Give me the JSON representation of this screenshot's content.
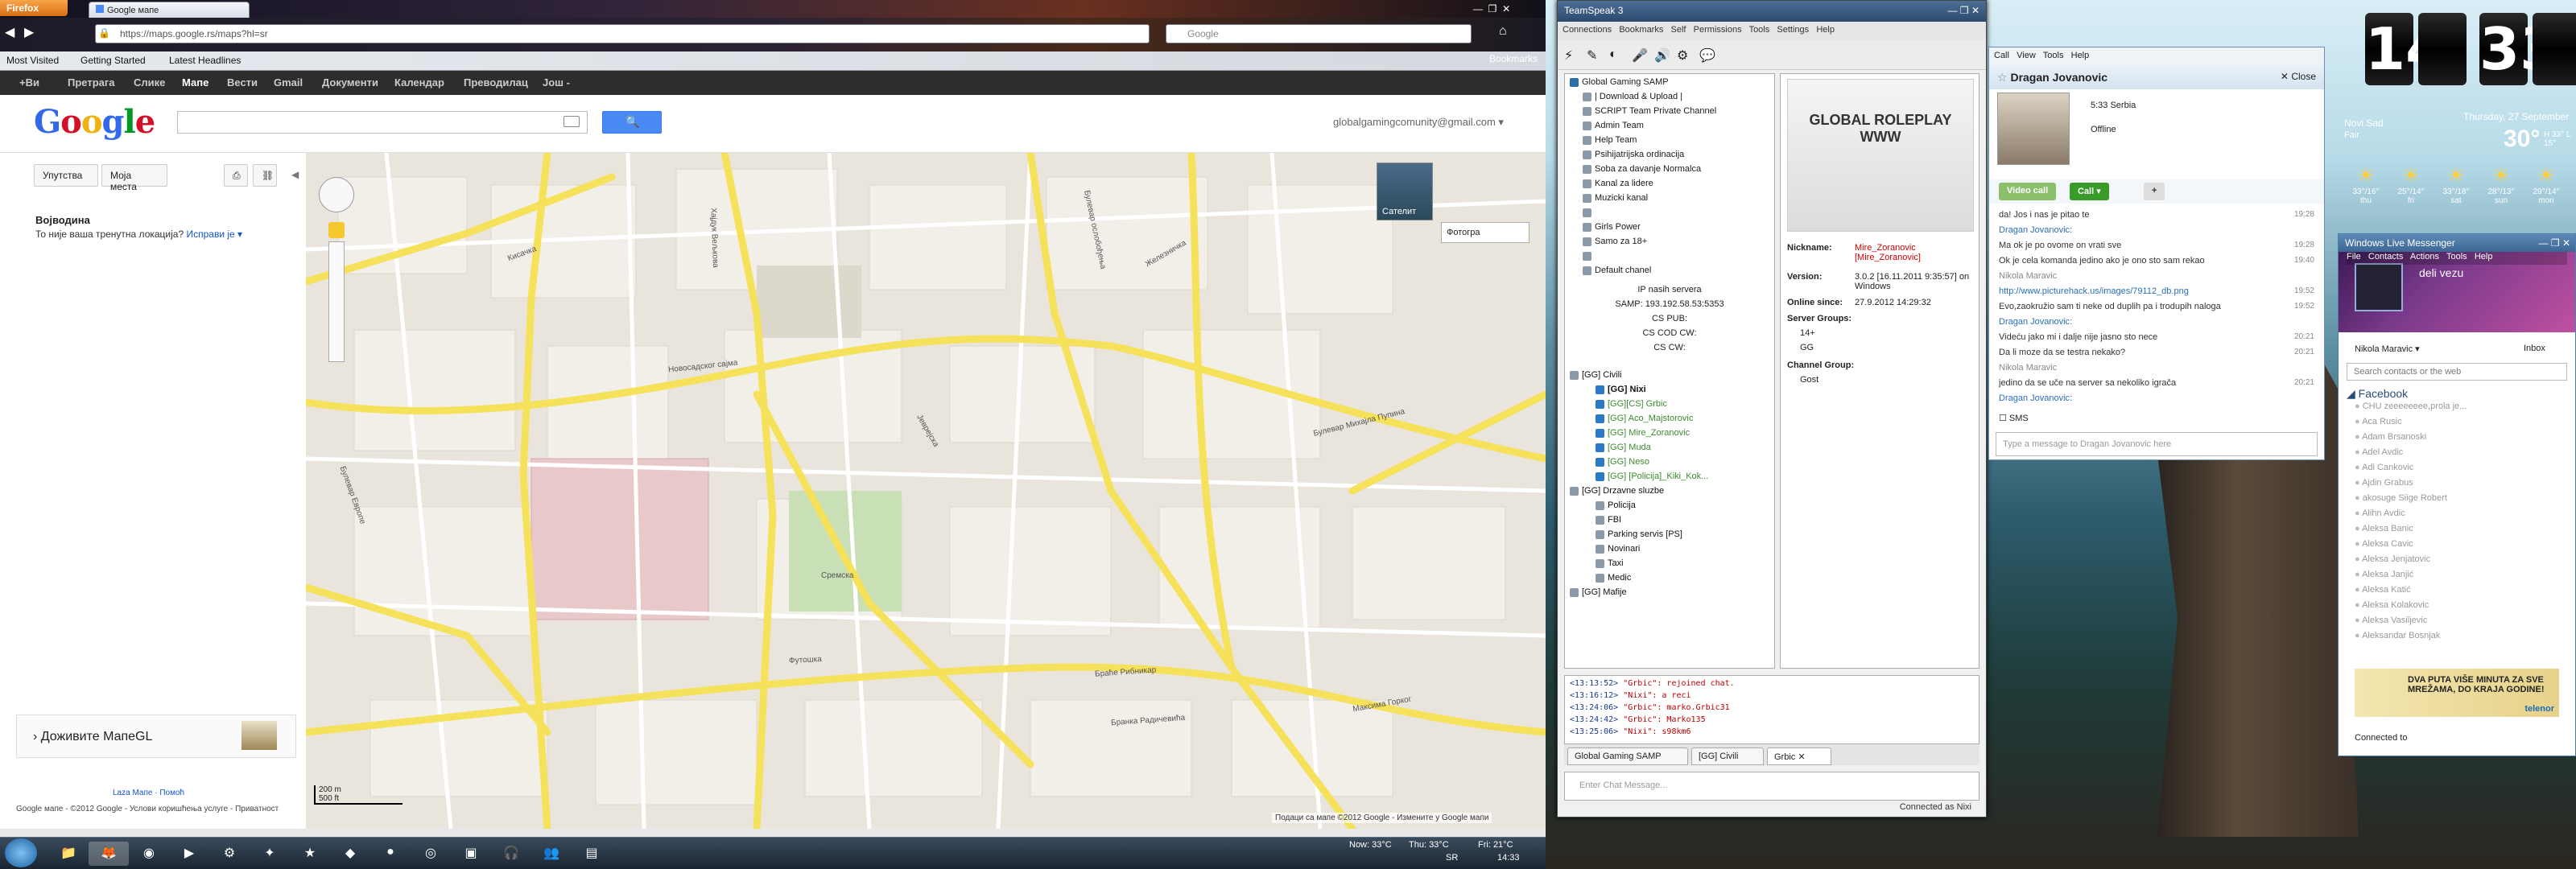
{
  "firefox": {
    "menu_label": "Firefox",
    "tab_label": "Google мапе",
    "url": "https://maps.google.rs/maps?hl=sr",
    "search_placeholder": "Google",
    "bookmarks": [
      "Most Visited",
      "Getting Started",
      "Latest Headlines"
    ],
    "bookmarks_right": "Bookmarks"
  },
  "gbar": {
    "items": [
      "+Ви",
      "Претрага",
      "Слике",
      "Мапе",
      "Вести",
      "Gmail",
      "Документи",
      "Календар",
      "Преводилац",
      "Још -"
    ]
  },
  "google": {
    "logo": "Google",
    "account": "globalgamingcomunity@gmail.com ▾",
    "buttons": [
      "Упутства",
      "Моја места"
    ],
    "region_title": "Војводина",
    "region_note": "То није ваша тренутна локација?",
    "region_fix": "Исправи је ▾",
    "maps_gl": "Доживите МапеGL",
    "footer1": "Laza Мапе · Помоћ",
    "footer2": "Google мапе - ©2012 Google - Услови коришћења услуге - Приватност",
    "map_type": "Сателит",
    "map_photos": "Фотогра",
    "scale_m": "200 m",
    "scale_ft": "500 ft",
    "map_copyright": "Подаци са мапе ©2012 Google - Измените у Google мапи",
    "map_streets": [
      "Булевар ослобођења",
      "Новосадског сајма",
      "Футошка",
      "Булевар Европе",
      "Јеврејска",
      "Бранка Радичевића",
      "Хајдук Вељкова",
      "Булевар Михајла Пупина",
      "Браће Рибникар",
      "Максима Горког",
      "Сремска",
      "Железничка",
      "Кисачка"
    ]
  },
  "taskbar": {
    "weather_now": "Now: 33°C",
    "weather_thu": "Thu: 33°C",
    "weather_fri": "Fri: 21°C",
    "lang": "SR",
    "time": "14:33"
  },
  "teamspeak": {
    "title": "TeamSpeak 3",
    "menu": [
      "Connections",
      "Bookmarks",
      "Self",
      "Permissions",
      "Tools",
      "Settings",
      "Help"
    ],
    "channels": [
      {
        "name": "Global Gaming SAMP",
        "level": 0,
        "color": "#1a1a1a"
      },
      {
        "name": "| Download & Upload |",
        "level": 1,
        "color": "#1a1a1a"
      },
      {
        "name": "SCRIPT Team Private Channel",
        "level": 1,
        "color": "#1a1a1a"
      },
      {
        "name": "Admin Team",
        "level": 1,
        "color": "#1a1a1a"
      },
      {
        "name": "Help Team",
        "level": 1,
        "color": "#1a1a1a"
      },
      {
        "name": "Psihijatrijska ordinacija",
        "level": 1,
        "color": "#1a1a1a"
      },
      {
        "name": "Soba za davanje Normalca",
        "level": 1,
        "color": "#1a1a1a"
      },
      {
        "name": "Kanal za lidere",
        "level": 1,
        "color": "#1a1a1a"
      },
      {
        "name": "Muzicki kanal",
        "level": 1,
        "color": "#1a1a1a"
      },
      {
        "name": "",
        "level": 1,
        "color": "#1a1a1a"
      },
      {
        "name": "Girls Power",
        "level": 1,
        "color": "#1a1a1a"
      },
      {
        "name": "Samo za 18+",
        "level": 1,
        "color": "#1a1a1a"
      },
      {
        "name": "",
        "level": 1,
        "color": "#1a1a1a"
      },
      {
        "name": "Default chanel",
        "level": 1,
        "color": "#1a1a1a"
      }
    ],
    "server_info": [
      "IP nasih servera",
      "SAMP: 193.192.58.53:5353",
      "CS PUB:",
      "CS COD CW:",
      "CS CW:"
    ],
    "civil_channel": "[GG] Civili",
    "clients": [
      {
        "name": "[GG] Nixi",
        "color": "#111",
        "bold": true
      },
      {
        "name": "[GG][CS] Grbic",
        "color": "#3b8b2e",
        "bold": false
      },
      {
        "name": "[GG] Aco_Majstorovic",
        "color": "#3b8b2e",
        "bold": false
      },
      {
        "name": "[GG] Mire_Zoranovic",
        "color": "#3b8b2e",
        "bold": false
      },
      {
        "name": "[GG] Muda",
        "color": "#3b8b2e",
        "bold": false
      },
      {
        "name": "[GG] Neso",
        "color": "#3b8b2e",
        "bold": false
      },
      {
        "name": "[GG] [Policija]_Kiki_Kok...",
        "color": "#3b8b2e",
        "bold": false
      }
    ],
    "state_channel": "[GG] Drzavne sluzbe",
    "state_subs": [
      "Policija",
      "FBI",
      "Parking servis [PS]",
      "Novinari",
      "Taxi",
      "Medic"
    ],
    "mafia_channel": "[GG] Mafije",
    "info": {
      "nickname_label": "Nickname:",
      "nickname": "Mire_Zoranovic [Mire_Zoranovic]",
      "version_label": "Version:",
      "version": "3.0.2 [16.11.2011 9:35:57] on Windows",
      "online_label": "Online since:",
      "online": "27.9.2012 14:29:32",
      "server_groups_label": "Server Groups:",
      "groups": [
        "14+",
        "GG"
      ],
      "channel_group_label": "Channel Group:",
      "channel_group": "Gost",
      "logo_text": "GLOBAL ROLEPLAY WWW"
    },
    "chat": [
      {
        "time": "<13:13:52>",
        "text": "\"Grbic\": rejoined chat."
      },
      {
        "time": "<13:16:12>",
        "text": "\"Nixi\": a reci"
      },
      {
        "time": "<13:24:06>",
        "text": "\"Grbic\": marko.Grbic31"
      },
      {
        "time": "<13:24:42>",
        "text": "\"Grbic\": Marko135"
      },
      {
        "time": "<13:25:06>",
        "text": "\"Nixi\": s98km6"
      }
    ],
    "tabs": [
      "Global Gaming SAMP",
      "[GG] Civili",
      "Grbic"
    ],
    "input_placeholder": "Enter Chat Message...",
    "status": "Connected as Nixi"
  },
  "wlm_chat": {
    "menu": [
      "Call",
      "View",
      "Tools",
      "Help"
    ],
    "contact": "Dragan Jovanovic",
    "close": "Close",
    "time_loc": "5:33 Serbia",
    "status": "Offline",
    "btn_video": "Video call",
    "btn_call": "Call ▾",
    "messages": [
      {
        "text": "da! Jos i nas je pitao te",
        "time": "19:28",
        "color": "#333"
      },
      {
        "text": "Dragan Jovanovic:",
        "time": "",
        "color": "#2a6ebb"
      },
      {
        "text": "Ma ok je po ovome on vrati sve",
        "time": "19:28",
        "color": "#333"
      },
      {
        "text": "Ok je cela komanda jedino ako je ono sto sam rekao",
        "time": "19:40",
        "color": "#333"
      },
      {
        "text": "Nikola Maravic",
        "time": "",
        "color": "#888"
      },
      {
        "text": "http://www.picturehack.us/images/79112_db.png",
        "time": "19:52",
        "color": "#2a6ebb"
      },
      {
        "text": "Evo,zaokružio sam ti neke od duplih pa i trodupih naloga",
        "time": "19:52",
        "color": "#333"
      },
      {
        "text": "Dragan Jovanovic:",
        "time": "",
        "color": "#2a6ebb"
      },
      {
        "text": "Videću jako mi i dalje nije jasno sto nece",
        "time": "20:21",
        "color": "#333"
      },
      {
        "text": "Da li moze da se testra nekako?",
        "time": "20:21",
        "color": "#333"
      },
      {
        "text": "Nikola Maravic",
        "time": "",
        "color": "#888"
      },
      {
        "text": "jedino da se uče na server sa nekoliko igrača",
        "time": "20:21",
        "color": "#333"
      },
      {
        "text": "Dragan Jovanovic:",
        "time": "",
        "color": "#2a6ebb"
      }
    ],
    "sms": "SMS",
    "input_placeholder": "Type a message to Dragan Jovanovic here"
  },
  "clock": {
    "hour": "14",
    "minute": "33",
    "city": "Novi Sad",
    "condition": "Fair",
    "date": "Thursday, 27 September",
    "temp": "30°",
    "range": "H 33° L 15°",
    "forecast": [
      {
        "t": "33°/16°",
        "d": "thu"
      },
      {
        "t": "25°/14°",
        "d": "fri"
      },
      {
        "t": "33°/18°",
        "d": "sat"
      },
      {
        "t": "28°/13°",
        "d": "sun"
      },
      {
        "t": "29°/14°",
        "d": "mon"
      }
    ]
  },
  "wlm_contacts": {
    "title": "Windows Live Messenger",
    "menu": [
      "File",
      "Contacts",
      "Actions",
      "Tools",
      "Help"
    ],
    "status_msg": "deli vezu",
    "me": "Nikola Maravic ▾",
    "inbox": "Inbox",
    "search_placeholder": "Search contacts or the web",
    "group": "Facebook",
    "contacts": [
      "CHU zeeeeeeee,prola je...",
      "Aca Rusic",
      "Adam Brsanoski",
      "Adel Avdic",
      "Adi Cankovic",
      "Ajdin Grabus",
      "akosuge Siige Robert",
      "Alihn Avdic",
      "Aleksa Banic",
      "Aleksa Cavic",
      "Aleksa Jenjatovic",
      "Aleksa Janjić",
      "Aleksa Katić",
      "Aleksa Kolakovic",
      "Aleksa Vasiljevic",
      "Aleksandar Bosnjak"
    ],
    "ad_text": "DVA PUTA VIŠE MINUTA ZA SVE MREŽAMA, DO KRAJA GODINE!",
    "ad_brand": "telenor",
    "connected": "Connected to"
  },
  "colors": {
    "gbar": "#2d2d2d",
    "map_bg": "#e9e5dc",
    "road": "#f6e15a",
    "ts_title": "#2c4a6e",
    "wlm_blue": "#2a6ebb",
    "green": "#3b8b2e"
  }
}
